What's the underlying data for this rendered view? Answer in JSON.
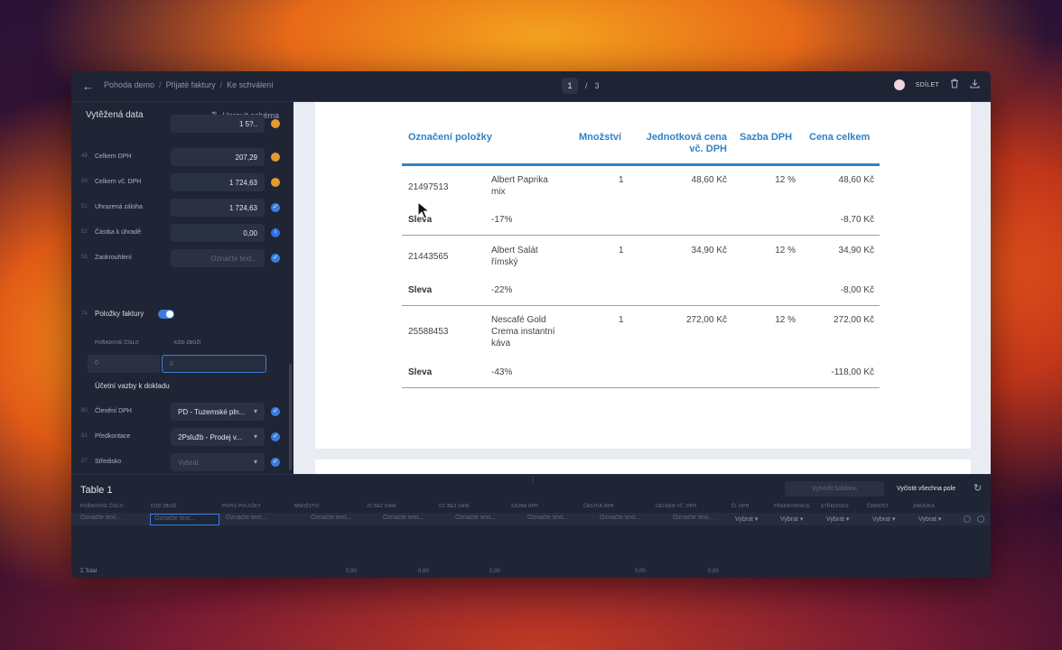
{
  "topbar": {
    "breadcrumb": [
      "Pohoda demo",
      "Přijaté faktury",
      "Ke schválení"
    ],
    "page_current": "1",
    "page_sep": "/",
    "page_total": "3",
    "share_label": "SDÍLET"
  },
  "sidebar": {
    "title": "Vytěžená data",
    "edit_schema": "Upravit schéma",
    "fields": [
      {
        "num": "",
        "label": "",
        "value": "1 5?..",
        "status": "orange"
      },
      {
        "num": "49",
        "label": "Celkem DPH",
        "value": "207,29",
        "status": "orange"
      },
      {
        "num": "50",
        "label": "Celkem vč. DPH",
        "value": "1 724,63",
        "status": "orange"
      },
      {
        "num": "51",
        "label": "Uhrazená záloha",
        "value": "1 724,63",
        "status": "blue"
      },
      {
        "num": "52",
        "label": "Částka k úhradě",
        "value": "0,00",
        "status": "info"
      },
      {
        "num": "53",
        "label": "Zaokrouhlení",
        "value": "Označte text...",
        "status": "blue"
      }
    ],
    "items_section": {
      "num": "74",
      "label": "Položky faktury"
    },
    "items_cols": [
      "POŘADOVÉ ČÍSLO",
      "KÓD ZBOŽÍ"
    ],
    "items_values": [
      "0",
      "0"
    ],
    "vazby_title": "Účetní vazby k dokladu",
    "vazby": [
      {
        "num": "80",
        "label": "Členění DPH",
        "value": "PD - Tuzemské pln...",
        "status": "blue"
      },
      {
        "num": "81",
        "label": "Předkontace",
        "value": "2Psluž­b - Prodej v...",
        "status": "blue"
      },
      {
        "num": "27",
        "label": "Středisko",
        "value": "Vybrat",
        "status": ""
      }
    ]
  },
  "document": {
    "headers": {
      "item": "Označení položky",
      "qty": "Množství",
      "unit_price_1": "Jednotková cena",
      "unit_price_2": "vč. DPH",
      "vat": "Sazba DPH",
      "total": "Cena celkem"
    },
    "rows": [
      {
        "code": "21497513",
        "name1": "Albert Paprika",
        "name2": "mix",
        "name3": "",
        "qty": "1",
        "price": "48,60 Kč",
        "vat": "12 %",
        "total": "48,60 Kč",
        "disc_label": "Sleva",
        "disc_pct": "-17%",
        "disc_total": "-8,70 Kč"
      },
      {
        "code": "21443565",
        "name1": "Albert Salát",
        "name2": "římský",
        "name3": "",
        "qty": "1",
        "price": "34,90 Kč",
        "vat": "12 %",
        "total": "34,90 Kč",
        "disc_label": "Sleva",
        "disc_pct": "-22%",
        "disc_total": "-8,00 Kč"
      },
      {
        "code": "25588453",
        "name1": "Nescafé Gold",
        "name2": "Crema instantní",
        "name3": "káva",
        "qty": "1",
        "price": "272,00 Kč",
        "vat": "12 %",
        "total": "272,00 Kč",
        "disc_label": "Sleva",
        "disc_pct": "-43%",
        "disc_total": "-118,00 Kč"
      }
    ]
  },
  "bottom": {
    "title": "Table 1",
    "create_template": "Vytvořit šablonu",
    "clear_all": "Vyčistit všechna pole",
    "columns": [
      "POŘADOVÉ ČÍSLO",
      "KÓD ZBOŽÍ",
      "POPIS POLOŽKY",
      "MNOŽSTVÍ",
      "JC BEZ DANÍ",
      "CC BEZ DANÍ",
      "SAZBA DPH",
      "ČÁSTKA DPH",
      "CELKEM VČ. DPH",
      "Čl. DPH",
      "PŘEDKONTACE",
      "STŘEDISKO",
      "ČINNOST",
      "ZAKÁZKA"
    ],
    "placeholder": "Označte text...",
    "select_placeholder": "Vybrat",
    "total_label": "Σ Total",
    "sums": [
      "0,00",
      "0,00",
      "0,00",
      "0,00",
      "0,00"
    ]
  }
}
